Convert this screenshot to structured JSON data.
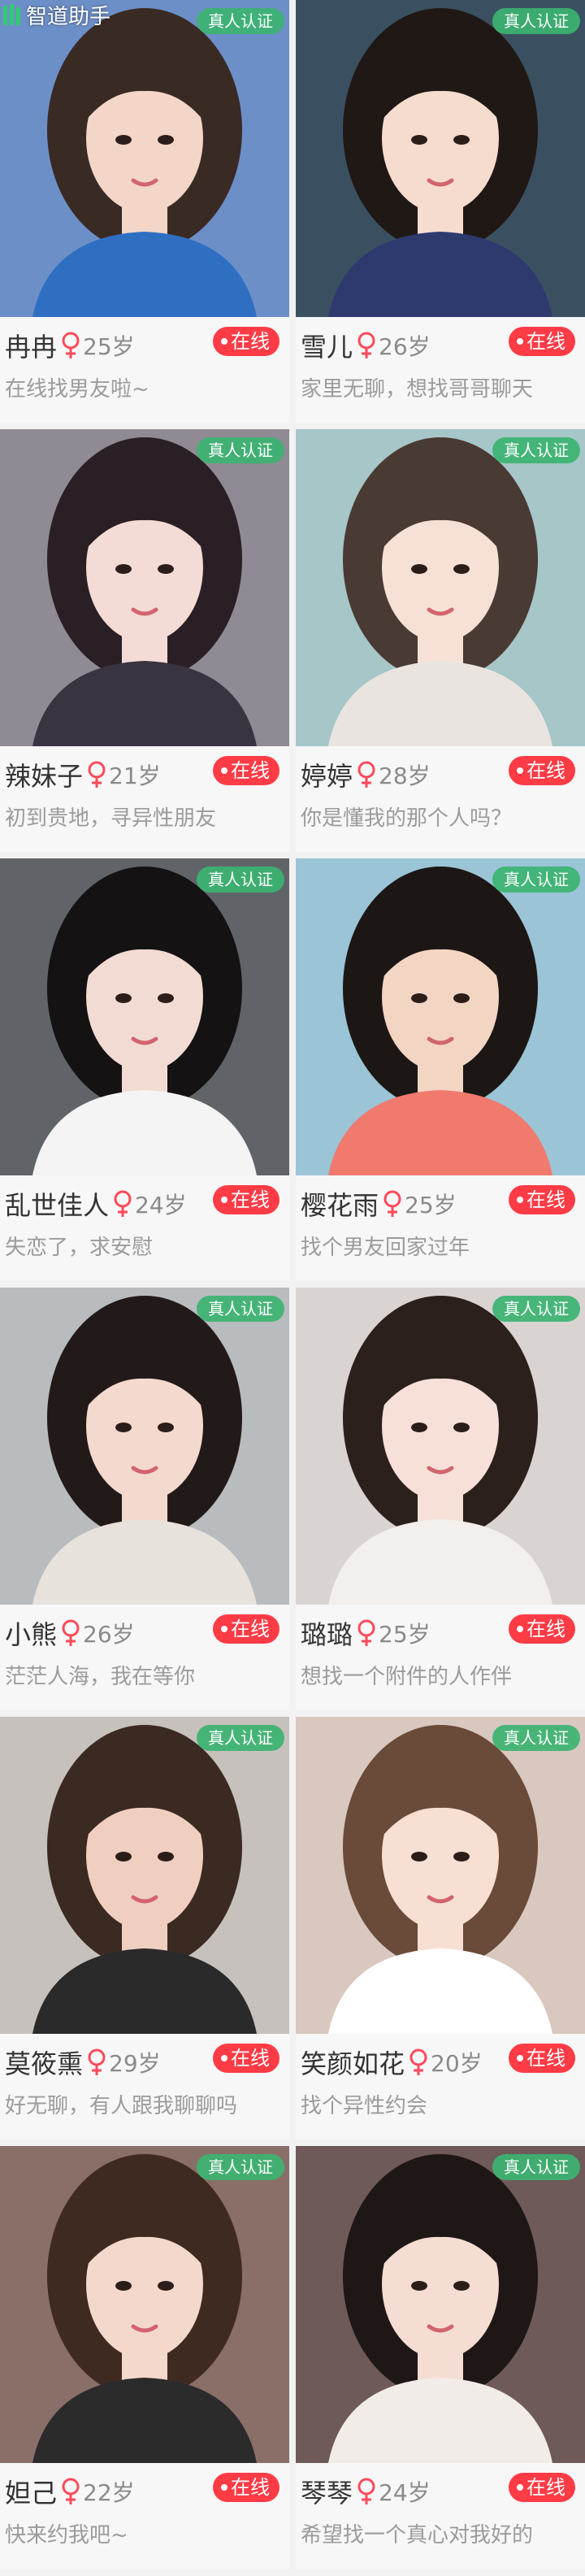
{
  "app": {
    "watermark_text": "智道助手"
  },
  "badge_label": "真人认证",
  "online_label": "在线",
  "colors": {
    "online": "#ff3b45",
    "badge": "#3cb371",
    "female_icon": "#ff4a5a"
  },
  "cards": [
    {
      "name": "冉冉",
      "age": "25岁",
      "status": "在线找男友啦~",
      "photo": {
        "bg": "#6d8fc8",
        "skin": "#f3d6c8",
        "hair": "#3a2a24",
        "top": "#2f6fc2"
      }
    },
    {
      "name": "雪儿",
      "age": "26岁",
      "status": "家里无聊，想找哥哥聊天",
      "photo": {
        "bg": "#3a5060",
        "skin": "#f6dccf",
        "hair": "#1f1815",
        "top": "#2e3a6e"
      }
    },
    {
      "name": "辣妹子",
      "age": "21岁",
      "status": "初到贵地，寻异性朋友",
      "photo": {
        "bg": "#8f8a93",
        "skin": "#f5dbd6",
        "hair": "#2a1f25",
        "top": "#3a3340"
      }
    },
    {
      "name": "婷婷",
      "age": "28岁",
      "status": "你是懂我的那个人吗？",
      "photo": {
        "bg": "#a6c6c8",
        "skin": "#f7e1d6",
        "hair": "#4a3a34",
        "top": "#e9e4df"
      }
    },
    {
      "name": "乱世佳人",
      "age": "24岁",
      "status": "失恋了，求安慰",
      "photo": {
        "bg": "#606468",
        "skin": "#f2dbd2",
        "hair": "#141212",
        "top": "#f4f4f4"
      }
    },
    {
      "name": "樱花雨",
      "age": "25岁",
      "status": "找个男友回家过年",
      "photo": {
        "bg": "#9bc4d6",
        "skin": "#f3d5c4",
        "hair": "#1c1714",
        "top": "#f07a6e"
      }
    },
    {
      "name": "小熊",
      "age": "26岁",
      "status": "茫茫人海，我在等你",
      "photo": {
        "bg": "#b9bcbf",
        "skin": "#f4d9cf",
        "hair": "#221a18",
        "top": "#e8e2dd"
      }
    },
    {
      "name": "璐璐",
      "age": "25岁",
      "status": "想找一个附件的人作伴",
      "photo": {
        "bg": "#d9d4d2",
        "skin": "#f6e0d8",
        "hair": "#2b201c",
        "top": "#f2efec"
      }
    },
    {
      "name": "莫筱熏",
      "age": "29岁",
      "status": "好无聊，有人跟我聊聊吗",
      "photo": {
        "bg": "#c7c1bd",
        "skin": "#f1cfc0",
        "hair": "#3a2a22",
        "top": "#2a2a2a"
      }
    },
    {
      "name": "笑颜如花",
      "age": "20岁",
      "status": "找个异性约会",
      "photo": {
        "bg": "#d9c8bf",
        "skin": "#f7dfd3",
        "hair": "#6a4a38",
        "top": "#ffffff"
      }
    },
    {
      "name": "妲己",
      "age": "22岁",
      "status": "快来约我吧~",
      "photo": {
        "bg": "#8a6f68",
        "skin": "#f4d8cc",
        "hair": "#3f2a22",
        "top": "#2b2b2b"
      }
    },
    {
      "name": "琴琴",
      "age": "24岁",
      "status": "希望找一个真心对我好的",
      "photo": {
        "bg": "#6e5a58",
        "skin": "#f5ddd3",
        "hair": "#1e1716",
        "top": "#f1ece8"
      }
    }
  ]
}
